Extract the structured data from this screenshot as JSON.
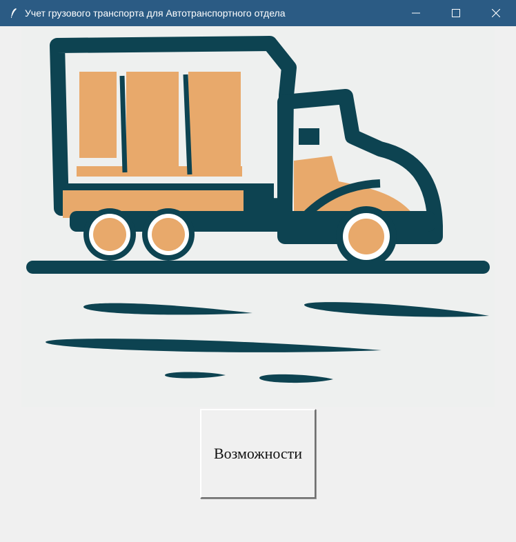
{
  "window": {
    "title": "Учет грузового транспорта для Автотранспортного отдела",
    "app_icon": "feather-icon",
    "titlebar_color": "#2b5b84",
    "controls": [
      "minimize-icon",
      "maximize-icon",
      "close-icon"
    ]
  },
  "illustration": {
    "subject": "truck-illustration",
    "colors": {
      "outline": "#0d4351",
      "cargo": "#e8a96b",
      "background": "#eef0ef"
    }
  },
  "main": {
    "features_button_label": "Возможности"
  }
}
